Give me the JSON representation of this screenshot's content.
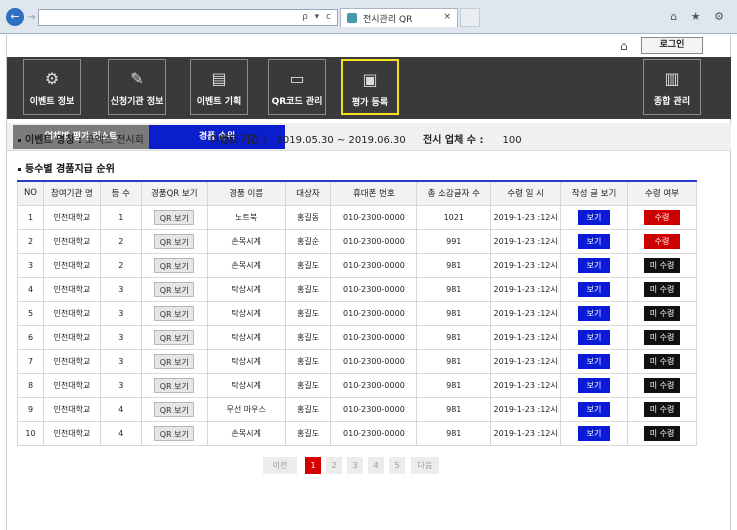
{
  "browser": {
    "tab_title": "전시관리 QR",
    "address_icons": "ρ ▾ c",
    "window_icons": "⌂ ★ ⚙"
  },
  "top": {
    "login_label": "로그인"
  },
  "nav": [
    {
      "label": "이벤트 정보",
      "icon": "gear-icon",
      "glyph": "⚙"
    },
    {
      "label": "신청기관 정보",
      "icon": "pencil-icon",
      "glyph": "✎"
    },
    {
      "label": "이벤트 기획",
      "icon": "database-icon",
      "glyph": "▤"
    },
    {
      "label": "QR코드 관리",
      "icon": "presentation-icon",
      "glyph": "▭"
    },
    {
      "label": "평가 등록",
      "icon": "document-search-icon",
      "glyph": "▣",
      "active": true
    },
    {
      "label": "종합 관리",
      "icon": "layout-icon",
      "glyph": "▥"
    }
  ],
  "subtabs": {
    "list": "업체별 평가 리스트",
    "rank": "경품 순위"
  },
  "info": {
    "event_name_label": "이벤트 명칭 : ",
    "event_name": "코엑스 전시회",
    "period_label": "이벤트 기간 :",
    "period": "2019.05.30 ~ 2019.06.30",
    "count_label": "전시 업체 수 :",
    "count": "100"
  },
  "section_title": "등수별 경품지급 순위",
  "table": {
    "headers": [
      "NO",
      "참여기관 명",
      "등 수",
      "경품QR 보기",
      "경품 이름",
      "대상자",
      "휴대폰 번호",
      "총 소감글자 수",
      "수령 일 시",
      "작성 글 보기",
      "수령 여부"
    ],
    "qr_label": "QR 보기",
    "view_label": "보기",
    "rows": [
      {
        "no": "1",
        "org": "인천대학교",
        "rank": "1",
        "prize": "노트북",
        "name": "홍길동",
        "phone": "010-2300-0000",
        "chars": "1021",
        "date": "2019-1-23 :12시",
        "status": "수령",
        "received": true
      },
      {
        "no": "2",
        "org": "인천대학교",
        "rank": "2",
        "prize": "손목시계",
        "name": "홍길순",
        "phone": "010-2300-0000",
        "chars": "991",
        "date": "2019-1-23 :12시",
        "status": "수령",
        "received": true
      },
      {
        "no": "3",
        "org": "인천대학교",
        "rank": "2",
        "prize": "손목시계",
        "name": "홍길도",
        "phone": "010-2300-0000",
        "chars": "981",
        "date": "2019-1-23 :12시",
        "status": "미 수령",
        "received": false
      },
      {
        "no": "4",
        "org": "인천대학교",
        "rank": "3",
        "prize": "탁상시계",
        "name": "홍길도",
        "phone": "010-2300-0000",
        "chars": "981",
        "date": "2019-1-23 :12시",
        "status": "미 수령",
        "received": false
      },
      {
        "no": "5",
        "org": "인천대학교",
        "rank": "3",
        "prize": "탁상시계",
        "name": "홍길도",
        "phone": "010-2300-0000",
        "chars": "981",
        "date": "2019-1-23 :12시",
        "status": "미 수령",
        "received": false
      },
      {
        "no": "6",
        "org": "인천대학교",
        "rank": "3",
        "prize": "탁상시계",
        "name": "홍길도",
        "phone": "010-2300-0000",
        "chars": "981",
        "date": "2019-1-23 :12시",
        "status": "미 수령",
        "received": false
      },
      {
        "no": "7",
        "org": "인천대학교",
        "rank": "3",
        "prize": "탁상시계",
        "name": "홍길도",
        "phone": "010-2300-0000",
        "chars": "981",
        "date": "2019-1-23 :12시",
        "status": "미 수령",
        "received": false
      },
      {
        "no": "8",
        "org": "인천대학교",
        "rank": "3",
        "prize": "탁상시계",
        "name": "홍길도",
        "phone": "010-2300-0000",
        "chars": "981",
        "date": "2019-1-23 :12시",
        "status": "미 수령",
        "received": false
      },
      {
        "no": "9",
        "org": "인천대학교",
        "rank": "4",
        "prize": "무선 마우스",
        "name": "홍길도",
        "phone": "010-2300-0000",
        "chars": "981",
        "date": "2019-1-23 :12시",
        "status": "미 수령",
        "received": false
      },
      {
        "no": "10",
        "org": "인천대학교",
        "rank": "4",
        "prize": "손목시계",
        "name": "홍길도",
        "phone": "010-2300-0000",
        "chars": "981",
        "date": "2019-1-23 :12시",
        "status": "미 수령",
        "received": false
      }
    ]
  },
  "pagination": {
    "prev": "이전",
    "pages": [
      "1",
      "2",
      "3",
      "4",
      "5"
    ],
    "current": "1",
    "next": "다음"
  },
  "colors": {
    "accent_blue": "#0a1ecb",
    "received_red": "#cc0000",
    "not_received_black": "#111111",
    "active_nav_border": "#f5e020"
  }
}
